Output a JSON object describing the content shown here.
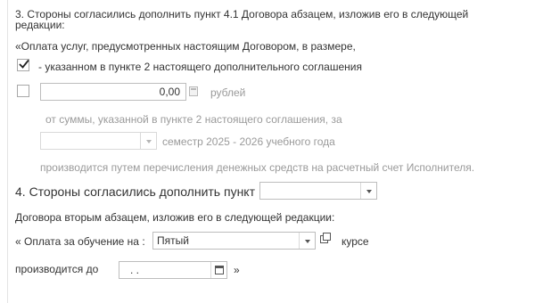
{
  "clause3": {
    "line1": "3. Стороны согласились дополнить пункт 4.1 Договора абзацем, изложив его в следующей",
    "line2": "редакции:",
    "quote_line": "«Оплата услуг, предусмотренных настоящим Договором, в размере,",
    "option1_label": "- указанном в пункте 2 настоящего дополнительного соглашения",
    "amount_value": "0,00",
    "currency_label": "рублей",
    "from_sum_text": "от суммы, указанной в пункте 2 настоящего соглашения, за",
    "semester_value": "",
    "semester_label": "семестр 2025 - 2026 учебного года",
    "payment_text": "производится путем перечисления денежных средств на расчетный счет Исполнителя."
  },
  "clause4": {
    "title": "4. Стороны согласились дополнить пункт :",
    "point_value": "",
    "second_para_text": "Договора вторым абзацем, изложив его в следующей редакции:",
    "payment_prefix": "« Оплата за обучение на :",
    "course_value": "Пятый",
    "course_suffix": "курсе",
    "due_prefix": "производится до",
    "due_date_value": ". .",
    "closing_quote": "»"
  },
  "state": {
    "option1_checked": true,
    "option2_checked": false
  }
}
